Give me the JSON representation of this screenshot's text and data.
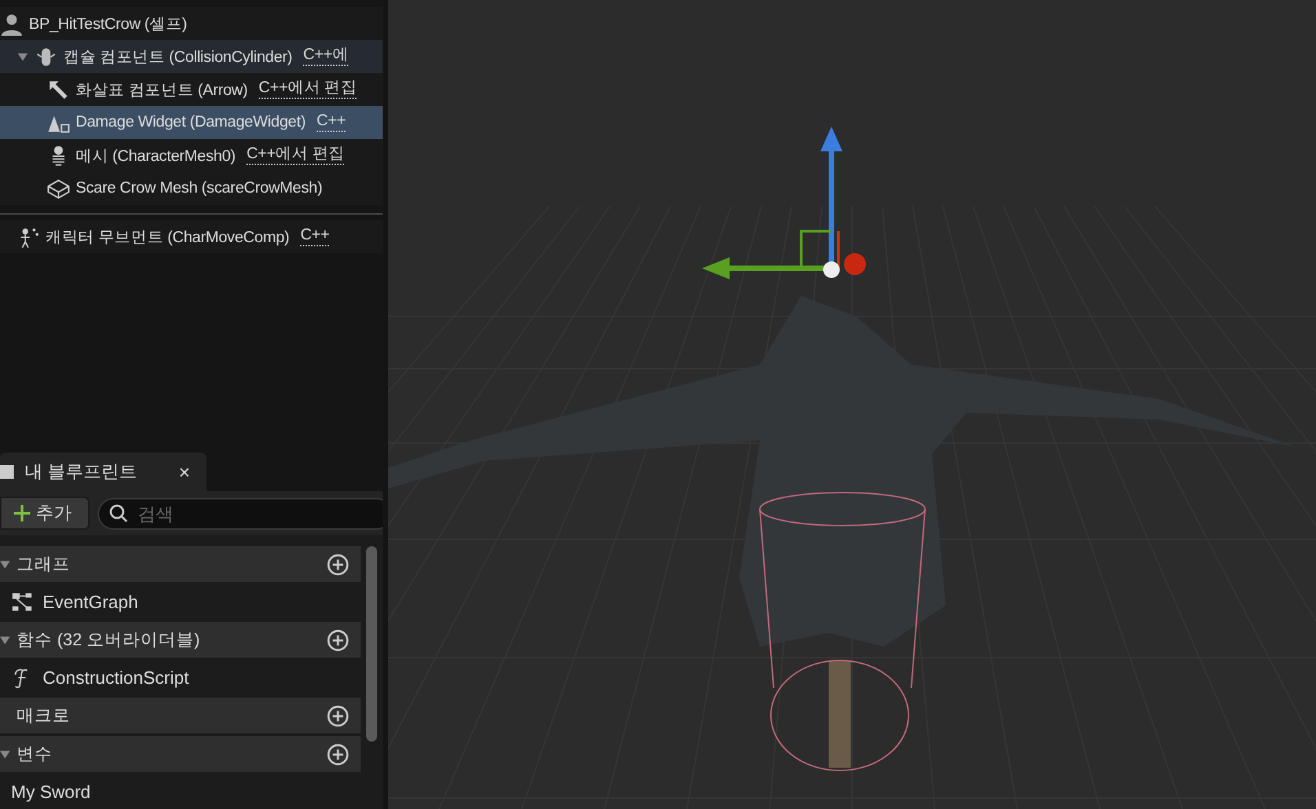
{
  "components": {
    "root": {
      "label": "BP_HitTestCrow (셀프)",
      "kind": "person"
    },
    "items": [
      {
        "label": "캡슐 컴포넌트 (CollisionCylinder)",
        "link": "C++에",
        "kind": "capsule",
        "selected": false,
        "expanded": true,
        "children": [
          {
            "label": "화살표 컴포넌트 (Arrow)",
            "link": "C++에서 편집",
            "kind": "arrow",
            "selected": false
          },
          {
            "label": "Damage Widget (DamageWidget)",
            "link": "C++",
            "kind": "widget",
            "selected": true
          },
          {
            "label": "메시 (CharacterMesh0)",
            "link": "C++에서 편집",
            "kind": "skeleton",
            "selected": false
          },
          {
            "label": "Scare Crow Mesh (scareCrowMesh)",
            "kind": "cube",
            "selected": false
          }
        ]
      },
      {
        "label": "캐릭터 무브먼트 (CharMoveComp)",
        "link": "C++",
        "kind": "movement",
        "selected": false
      }
    ]
  },
  "my_blueprint": {
    "tab": {
      "label": "내 블루프린트",
      "close": "×"
    },
    "add_button": "추가",
    "search": {
      "placeholder": "검색"
    },
    "sections": [
      {
        "kind": "header",
        "label": "그래프",
        "expanded": true
      },
      {
        "kind": "graph",
        "label": "EventGraph"
      },
      {
        "kind": "header",
        "label": "함수 (32 오버라이더블)",
        "expanded": true
      },
      {
        "kind": "function",
        "label": "ConstructionScript"
      },
      {
        "kind": "header",
        "label": "매크로",
        "expanded": false
      },
      {
        "kind": "header",
        "label": "변수",
        "expanded": true
      },
      {
        "kind": "variable",
        "label": "My Sword"
      }
    ]
  }
}
